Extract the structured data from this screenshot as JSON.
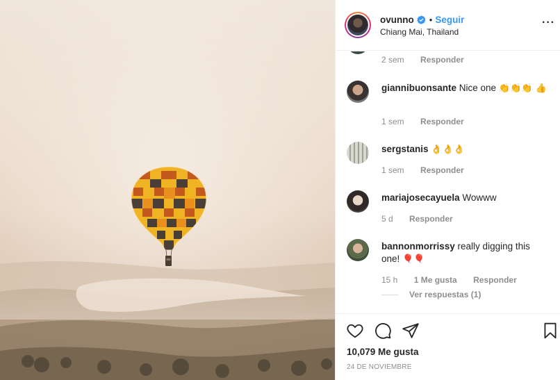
{
  "post": {
    "owner": {
      "username": "ovunno",
      "verified_icon": "verified-badge-icon",
      "separator": "•",
      "follow_label": "Seguir",
      "location": "Chiang Mai, Thailand"
    },
    "more_icon": "more-options-icon",
    "more_label": "···"
  },
  "comments": {
    "previous_meta": {
      "time": "2 sem",
      "reply_label": "Responder"
    },
    "items": [
      {
        "username": "giannibuonsante",
        "text": "Nice one",
        "emoji": "👏👏👏 👍",
        "time": "1 sem",
        "reply_label": "Responder"
      },
      {
        "username": "sergstanis",
        "text": "",
        "emoji": "👌👌👌",
        "time": "1 sem",
        "reply_label": "Responder"
      },
      {
        "username": "mariajosecayuela",
        "text": "Wowww",
        "emoji": "",
        "time": "5 d",
        "reply_label": "Responder"
      },
      {
        "username": "bannonmorrissy",
        "text": "really digging this one!",
        "emoji": "🎈🎈",
        "time": "15 h",
        "likes_label": "1 Me gusta",
        "reply_label": "Responder",
        "view_replies_label": "Ver respuestas (1)"
      }
    ]
  },
  "actions": {
    "icons": [
      "heart-icon",
      "comment-icon",
      "share-icon",
      "bookmark-icon"
    ],
    "likes_label": "10,079 Me gusta",
    "date_label": "24 DE NOVIEMBRE"
  },
  "colors": {
    "accent": "#3897f0",
    "text": "#262626",
    "muted": "#8e8e8e",
    "border": "#efefef"
  }
}
